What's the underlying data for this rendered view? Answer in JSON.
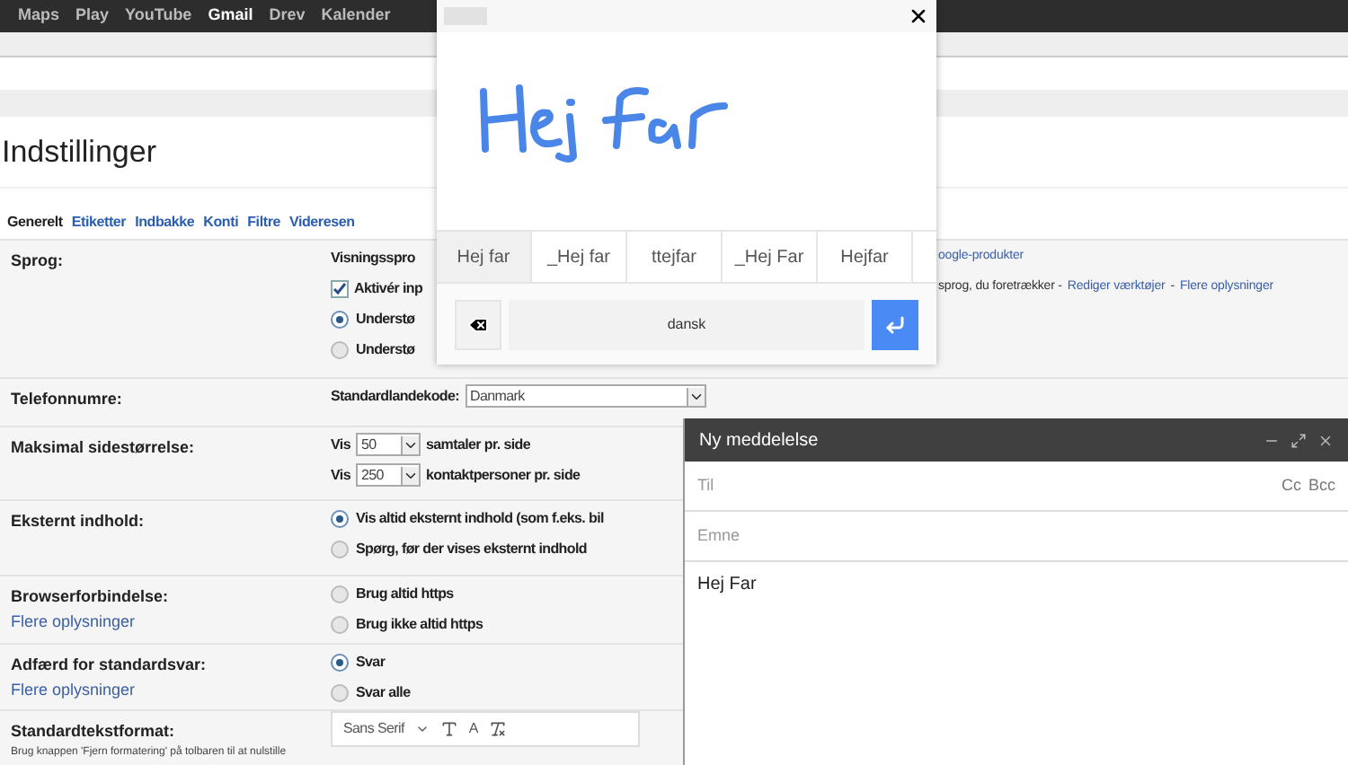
{
  "top_bar": {
    "links": [
      {
        "label": "Maps",
        "selected": false
      },
      {
        "label": "Play",
        "selected": false
      },
      {
        "label": "YouTube",
        "selected": false
      },
      {
        "label": "Gmail",
        "selected": true
      },
      {
        "label": "Drev",
        "selected": false
      },
      {
        "label": "Kalender",
        "selected": false
      }
    ]
  },
  "page_title": "Indstillinger",
  "tabs": [
    {
      "label": "Generelt",
      "selected": true
    },
    {
      "label": "Etiketter",
      "selected": false
    },
    {
      "label": "Indbakke",
      "selected": false
    },
    {
      "label": "Konti",
      "selected": false
    },
    {
      "label": "Filtre",
      "selected": false
    },
    {
      "label": "Videresen",
      "selected": false
    }
  ],
  "settings": [
    {
      "label": "Sprog:",
      "lines": [
        {
          "kind": "text",
          "text": "Visningsspro",
          "tail": [
            {
              "text": "oogle-produkter",
              "link": true
            }
          ]
        },
        {
          "kind": "checkbox",
          "label": "Aktivér inp",
          "checked": true,
          "tail": [
            {
              "text": "sprog, du foretrækker -",
              "link": false
            },
            {
              "text": "Rediger værktøjer",
              "link": true
            },
            {
              "text": "-",
              "link": false
            },
            {
              "text": "Flere oplysninger",
              "link": true
            }
          ]
        },
        {
          "kind": "radio",
          "label": "Understø",
          "selected": true
        },
        {
          "kind": "radio",
          "label": "Understø",
          "selected": false
        }
      ]
    },
    {
      "label": "Telefonnumre:",
      "lines": [
        {
          "kind": "select",
          "prefix": "Standardlandekode:",
          "value": "Danmark",
          "wide": true
        }
      ]
    },
    {
      "label": "Maksimal sidestørrelse:",
      "lines": [
        {
          "kind": "select",
          "prefix": "Vis",
          "value": "50",
          "suffix": "samtaler pr. side",
          "wide": false
        },
        {
          "kind": "select",
          "prefix": "Vis",
          "value": "250",
          "suffix": "kontaktpersoner pr. side",
          "wide": false
        }
      ]
    },
    {
      "label": "Eksternt indhold:",
      "lines": [
        {
          "kind": "radio",
          "label": "Vis altid eksternt indhold (som f.eks. bil",
          "selected": true
        },
        {
          "kind": "radio",
          "label": "Spørg, før der vises eksternt indhold",
          "selected": false
        }
      ]
    },
    {
      "label": "Browserforbindelse:",
      "link": "Flere oplysninger",
      "lines": [
        {
          "kind": "radio",
          "label": "Brug altid https",
          "selected": false
        },
        {
          "kind": "radio",
          "label": "Brug ikke altid https",
          "selected": false
        }
      ]
    },
    {
      "label": "Adfærd for standardsvar:",
      "link": "Flere oplysninger",
      "lines": [
        {
          "kind": "radio",
          "label": "Svar",
          "selected": true
        },
        {
          "kind": "radio",
          "label": "Svar alle",
          "selected": false
        }
      ]
    },
    {
      "label": "Standardtekstformat:",
      "help": "Brug knappen 'Fjern formatering' på tolbaren til at nulstille",
      "lines": [
        {
          "kind": "toolbar",
          "font": "Sans Serif",
          "color_label": "A"
        }
      ]
    }
  ],
  "handwriting_panel": {
    "candidates": [
      {
        "label": "Hej far",
        "selected": true
      },
      {
        "label": "_Hej far",
        "selected": false
      },
      {
        "label": "ttejfar",
        "selected": false
      },
      {
        "label": "_Hej Far",
        "selected": false
      },
      {
        "label": "Hejfar",
        "selected": false
      }
    ],
    "language": "dansk"
  },
  "compose": {
    "title": "Ny meddelelse",
    "to_placeholder": "Til",
    "cc": "Cc",
    "bcc": "Bcc",
    "subject_placeholder": "Emne",
    "body": "Hej Far"
  }
}
